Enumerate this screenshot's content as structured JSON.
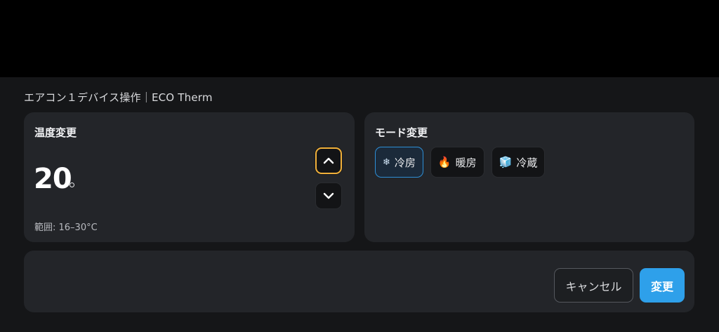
{
  "dialog": {
    "title": "エアコン１デバイス操作｜ECO Therm"
  },
  "temperature": {
    "heading": "温度変更",
    "value": "20",
    "range": "範囲: 16–30°C",
    "increase_icon": "chevron-up-icon",
    "decrease_icon": "chevron-down-icon"
  },
  "mode": {
    "heading": "モード変更",
    "options": [
      {
        "icon": "snowflake-icon",
        "glyph": "❄",
        "label": "冷房",
        "selected": true
      },
      {
        "icon": "fire-icon",
        "glyph": "🔥",
        "label": "暖房",
        "selected": false
      },
      {
        "icon": "ice-cube-icon",
        "glyph": "🧊",
        "label": "冷蔵",
        "selected": false
      }
    ]
  },
  "actions": {
    "cancel_label": "キャンセル",
    "apply_label": "変更"
  },
  "colors": {
    "accent_blue": "#2ea0ea",
    "focus_ring": "#f0b03a",
    "card_bg": "#232529",
    "sheet_bg": "#151618"
  }
}
